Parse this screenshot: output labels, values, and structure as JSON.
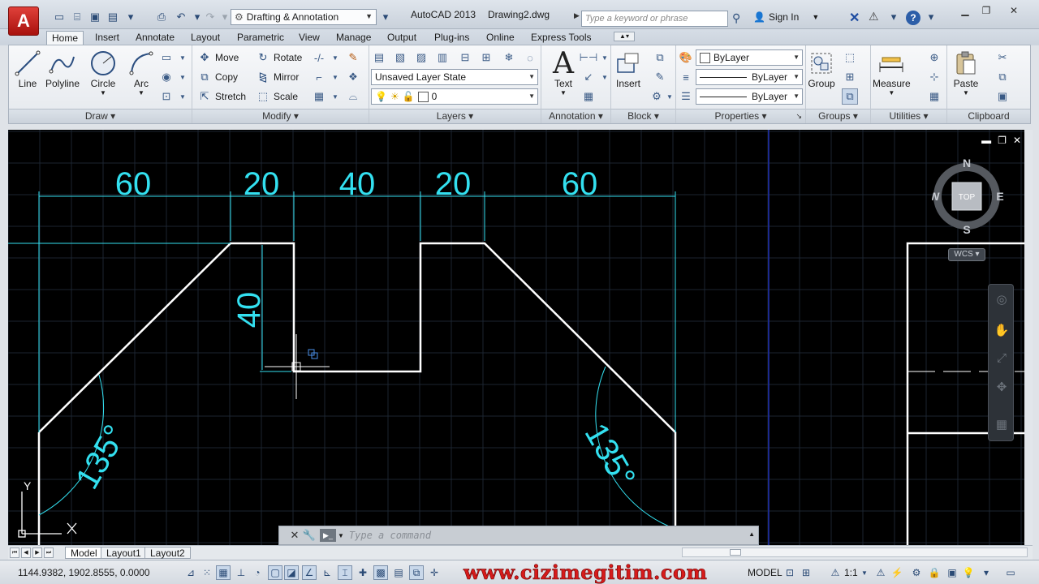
{
  "titlebar": {
    "workspace": "Drafting & Annotation",
    "app_title": "AutoCAD 2013",
    "doc_title": "Drawing2.dwg",
    "search_placeholder": "Type a keyword or phrase",
    "sign_in": "Sign In"
  },
  "ribbon_tabs": [
    "Home",
    "Insert",
    "Annotate",
    "Layout",
    "Parametric",
    "View",
    "Manage",
    "Output",
    "Plug-ins",
    "Online",
    "Express Tools"
  ],
  "panels": {
    "draw": {
      "title": "Draw",
      "tools": [
        "Line",
        "Polyline",
        "Circle",
        "Arc"
      ]
    },
    "modify": {
      "title": "Modify",
      "tools": [
        "Move",
        "Rotate",
        "Copy",
        "Mirror",
        "Stretch",
        "Scale"
      ]
    },
    "layers": {
      "title": "Layers",
      "layer_state": "Unsaved Layer State",
      "current_layer": "0"
    },
    "annotation": {
      "title": "Annotation",
      "text": "Text"
    },
    "block": {
      "title": "Block",
      "insert": "Insert"
    },
    "properties": {
      "title": "Properties",
      "color": "ByLayer",
      "linetype": "ByLayer",
      "lineweight": "ByLayer"
    },
    "groups": {
      "title": "Groups",
      "group": "Group"
    },
    "utilities": {
      "title": "Utilities",
      "measure": "Measure"
    },
    "clipboard": {
      "title": "Clipboard",
      "paste": "Paste"
    }
  },
  "drawing": {
    "dimensions": [
      "60",
      "20",
      "40",
      "20",
      "60"
    ],
    "vertical_dim": "40",
    "angle_left": "135°",
    "angle_right": "135°",
    "ucs_y": "Y",
    "ucs_x": "X",
    "colors": {
      "background": "#000000",
      "geometry": "#ffffff",
      "dimension": "#33e0f0",
      "grid": "#1c2531"
    }
  },
  "viewcube": {
    "north": "N",
    "south": "S",
    "east": "E",
    "west": "W",
    "face": "TOP",
    "wcs": "WCS"
  },
  "command_line": {
    "placeholder": "Type a command"
  },
  "layout_tabs": [
    "Model",
    "Layout1",
    "Layout2"
  ],
  "statusbar": {
    "coords": "1144.9382, 1902.8555, 0.0000",
    "watermark": "www.cizimegitim.com",
    "model": "MODEL",
    "scale": "1:1"
  }
}
